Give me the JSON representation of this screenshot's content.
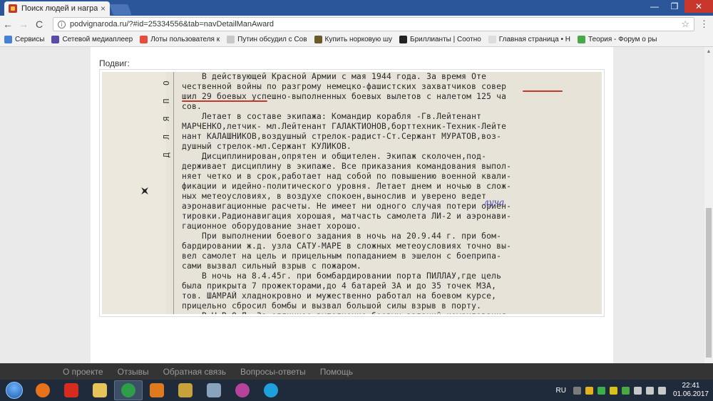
{
  "browser": {
    "tab_title": "Поиск людей и награжд",
    "tab_close": "×",
    "window_controls": {
      "minimize": "—",
      "maximize": "❐",
      "close": "✕"
    },
    "back": "←",
    "forward": "→",
    "reload": "C",
    "url": "podvignaroda.ru/?#id=25334556&tab=navDetailManAward",
    "star": "☆",
    "menu": "⋮"
  },
  "bookmarks": [
    {
      "label": "Сервисы",
      "icon_color": "#4a7fd6",
      "icon": "apps-icon"
    },
    {
      "label": "Сетевой медиаплеер",
      "icon_color": "#5b4aa8",
      "icon": "media-icon"
    },
    {
      "label": "Лоты пользователя к",
      "icon_color": "#e74c3c",
      "icon": "paw-icon"
    },
    {
      "label": "Путин обсудил с Сов",
      "icon_color": "#c8c8c8",
      "icon": "page-icon"
    },
    {
      "label": "Купить норковую шу",
      "icon_color": "#6a5a2a",
      "icon": "badge-icon"
    },
    {
      "label": "Бриллианты | Соотно",
      "icon_color": "#222222",
      "icon": "figure-icon"
    },
    {
      "label": "Главная страница • Н",
      "icon_color": "#dddddd",
      "icon": "doc-icon"
    },
    {
      "label": "Теория - Форум о ры",
      "icon_color": "#49a84a",
      "icon": "leaf-icon"
    }
  ],
  "page": {
    "section_label": "Подвиг:",
    "margin_vertical_text": "Д Л Я   П О",
    "document_lines": [
      "    В действующей Красной Армии с мая 1944 года. За время Оте",
      "чественной войны по разгрому немецко-фашистских захватчиков совер",
      "шил 29 боевых успешно-выполненных боевых вылетов с налетом 125 ча",
      "сов.",
      "    Летает в составе экипажа: Командир корабля -Гв.Лейтенант",
      "МАРЧЕНКО,летчик- мл.Лейтенант ГАЛАКТИОНОВ,борттехник-Техник-Лейте",
      "нант КАЛАШНИКОВ,воздушный стрелок-радист-Ст.Сержант МУРАТОВ,воз-",
      "душный стрелок-мл.Сержант КУЛИКОВ.",
      "    Дисциплинирован,опрятен и общителен. Экипаж сколочен,под-",
      "держивает дисциплину в экипаже. Все приказания командования выпол-",
      "няет четко и в срок,работает над собой по повышению военной квали-",
      "фикации и идейно-политического уровня. Летает днем и ночью в слож-",
      "ных метеоусловиях, в воздухе спокоен,вынослив и уверено ведет",
      "аэронавигационные расчеты. Не имеет ни одного случая потери ориен-",
      "тировки.Радионавигация хорошая, матчасть самолета ЛИ-2 и аэронави-",
      "гационное оборудование знает хорошо.",
      "    При выполнении боевого задания в ночь на 20.9.44 г. при бом-",
      "бардировании ж.д. узла САТУ-МАРЕ в сложных метеоусловиях точно вы-",
      "вел самолет на цель и прицельным попаданием в эшелон с боеприпа-",
      "сами вызвал сильный взрыв с пожаром.",
      "    В ночь на 8.4.45г. при бомбардировании порта ПИЛЛАУ,где цель",
      "была прикрыта 7 прожекторами,до 4 батарей ЗА и до 35 точек МЗА,",
      "тов. ШАМРАЙ хладнокровно и мужественно работал на боевом курсе,",
      "прицельно сбросил бомбы и вызвал большой силы взрыв в порту.",
      "    В Ы В О Д: За отличное выполнение боевых заданий командования"
    ],
    "handwritten_note": "луча"
  },
  "footer": {
    "links": [
      "О проекте",
      "Отзывы",
      "Обратная связь",
      "Вопросы-ответы",
      "Помощь"
    ]
  },
  "taskbar": {
    "apps": [
      {
        "name": "firefox",
        "color": "#e8711c"
      },
      {
        "name": "yandex",
        "color": "#d62b1f"
      },
      {
        "name": "file-explorer",
        "color": "#e6c45a"
      },
      {
        "name": "chrome",
        "color": "#2e9d4a",
        "active": true
      },
      {
        "name": "media-player",
        "color": "#e07a1f"
      },
      {
        "name": "unknown-app",
        "color": "#c7a23a"
      },
      {
        "name": "calculator",
        "color": "#8aa3bd"
      },
      {
        "name": "picasa",
        "color": "#b5439b"
      },
      {
        "name": "skype",
        "color": "#1ea0dc"
      }
    ],
    "language": "RU",
    "tray_icons": [
      "#7b7b7b",
      "#e3b21c",
      "#3bb04a",
      "#d8c21a",
      "#4aa842",
      "#c8c8c8",
      "#c8c8c8",
      "#c8c8c8"
    ],
    "time": "22:41",
    "date": "01.06.2017"
  }
}
